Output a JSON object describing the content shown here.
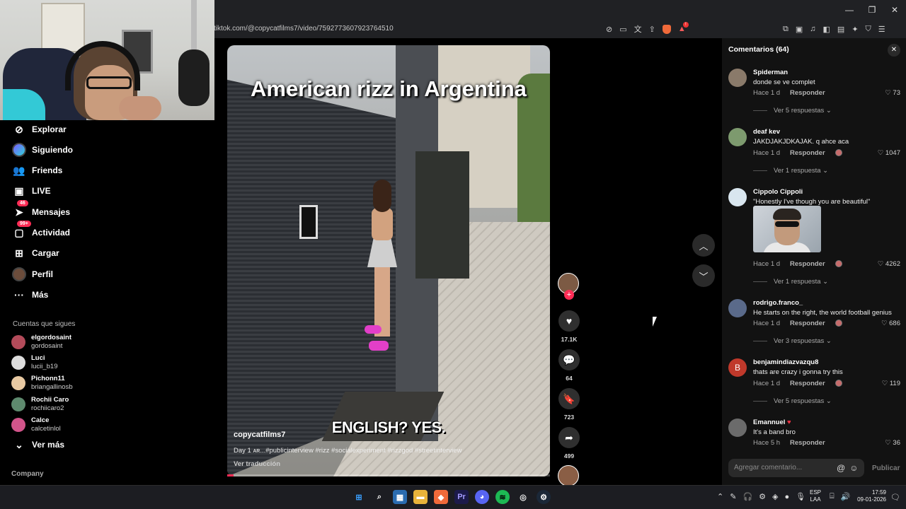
{
  "browser": {
    "url": "tiktok.com/@copycatfilms7/video/7592773607923764510",
    "window_controls": [
      "—",
      "❐",
      "✕"
    ]
  },
  "sidebar": {
    "nav": [
      {
        "label": "Explorar",
        "icon": "compass-icon"
      },
      {
        "label": "Siguiendo",
        "icon": "following-icon"
      },
      {
        "label": "Friends",
        "icon": "friends-icon"
      },
      {
        "label": "LIVE",
        "icon": "live-icon"
      },
      {
        "label": "Mensajes",
        "icon": "messages-icon",
        "badge": "46"
      },
      {
        "label": "Actividad",
        "icon": "activity-icon",
        "badge": "99+"
      },
      {
        "label": "Cargar",
        "icon": "upload-icon"
      },
      {
        "label": "Perfil",
        "icon": "profile-icon"
      },
      {
        "label": "Más",
        "icon": "more-icon"
      }
    ],
    "following_title": "Cuentas que sigues",
    "following": [
      {
        "name": "elgordosaint",
        "handle": "gordosaint"
      },
      {
        "name": "Luci",
        "handle": "lucii_b19"
      },
      {
        "name": "Pichonn11",
        "handle": "briangallinosb"
      },
      {
        "name": "Rochii Caro",
        "handle": "rochiicaro2"
      },
      {
        "name": "Calce",
        "handle": "calcetinlol"
      }
    ],
    "see_more": "Ver más",
    "company": "Company"
  },
  "video": {
    "title_overlay": "American rizz in Argentina",
    "caption_overlay": "ENGLISH? YES.",
    "author": "copycatfilms7",
    "description": "Day 1 ᴀʀ...#publicinterview #rizz #socialexperiment #rizzgod #streetinterview",
    "translate": "Ver traducción",
    "progress": 0.02
  },
  "actions": {
    "likes": "17.1K",
    "comments": "64",
    "saves": "723",
    "shares": "499"
  },
  "comments_panel": {
    "title": "Comentarios (64)",
    "input_placeholder": "Agregar comentario...",
    "post_label": "Publicar",
    "reply_label": "Responder",
    "items": [
      {
        "user": "Spiderman",
        "text": "donde se ve complet",
        "time": "Hace 1 d",
        "likes": "73",
        "replies": "Ver 5 respuestas"
      },
      {
        "user": "deaf kev",
        "text": "JAKDJAKJDKAJAK. q ahce aca",
        "time": "Hace 1 d",
        "likes": "1047",
        "replies": "Ver 1 respuesta"
      },
      {
        "user": "Cippolo Cippoli",
        "text": "\"Honestly I've though you are beautiful\"",
        "time": "Hace 1 d",
        "likes": "4262",
        "replies": "Ver 1 respuesta"
      },
      {
        "user": "rodrigo.franco_",
        "text": "He starts on the right, the world football genius",
        "time": "Hace 1 d",
        "likes": "686",
        "replies": "Ver 3 respuestas"
      },
      {
        "user": "benjamindiazvazqu8",
        "text": "thats are crazy i gonna try this",
        "time": "Hace 1 d",
        "likes": "119",
        "replies": "Ver 5 respuestas",
        "avatar_letter": "B"
      },
      {
        "user": "Emannuel",
        "text": "It's a band bro",
        "time": "Hace 5 h",
        "likes": "36"
      }
    ]
  },
  "taskbar": {
    "lang": "ESP",
    "lang2": "LAA",
    "time": "17:59",
    "date": "09-01-2026"
  }
}
